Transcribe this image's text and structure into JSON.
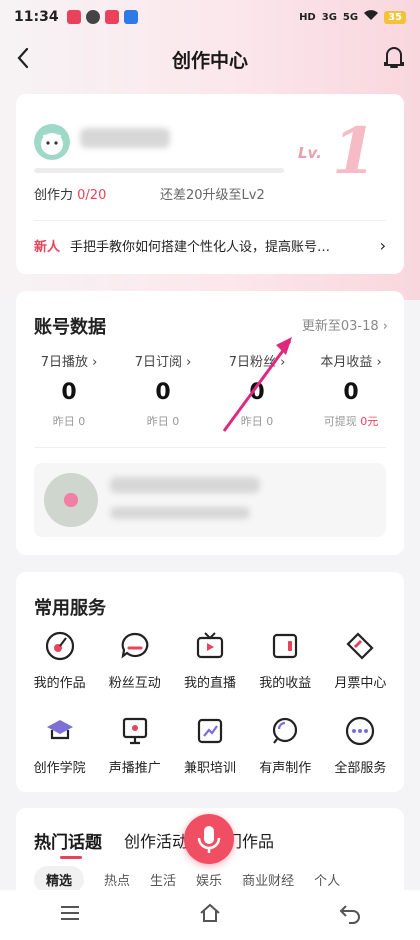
{
  "status_bar": {
    "time": "11:34",
    "signal_labels": [
      "HD",
      "3G",
      "5G"
    ],
    "battery": "35"
  },
  "header": {
    "title": "创作中心"
  },
  "profile": {
    "power_label": "创作力",
    "power_value": "0/20",
    "power_progress_fraction": 0,
    "upgrade_hint": "还差20升级至Lv2",
    "level_prefix": "Lv.",
    "level_number": "1",
    "tip_tag": "新人",
    "tip_text": "手把手教你如何搭建个性化人设，提高账号…",
    "tip_arrow": "›"
  },
  "account": {
    "title": "账号数据",
    "update_text": "更新至03-18 ›",
    "stats": [
      {
        "label": "7日播放 ›",
        "value": "0",
        "sub": "昨日 0",
        "sub_highlight": ""
      },
      {
        "label": "7日订阅 ›",
        "value": "0",
        "sub": "昨日 0",
        "sub_highlight": ""
      },
      {
        "label": "7日粉丝 ›",
        "value": "0",
        "sub": "昨日 0",
        "sub_highlight": ""
      },
      {
        "label": "本月收益 ›",
        "value": "0",
        "sub": "可提现 ",
        "sub_highlight": "0元"
      }
    ]
  },
  "services": {
    "title": "常用服务",
    "items": [
      {
        "label": "我的作品",
        "icon": "works-icon"
      },
      {
        "label": "粉丝互动",
        "icon": "chat-icon"
      },
      {
        "label": "我的直播",
        "icon": "live-icon"
      },
      {
        "label": "我的收益",
        "icon": "wallet-icon"
      },
      {
        "label": "月票中心",
        "icon": "ticket-icon"
      },
      {
        "label": "创作学院",
        "icon": "academy-icon"
      },
      {
        "label": "声播推广",
        "icon": "promote-icon"
      },
      {
        "label": "兼职培训",
        "icon": "training-icon"
      },
      {
        "label": "有声制作",
        "icon": "audio-make-icon"
      },
      {
        "label": "全部服务",
        "icon": "more-icon"
      }
    ]
  },
  "topics": {
    "tabs": [
      "热门话题",
      "创作活动",
      "热门作品"
    ],
    "chips": [
      "精选",
      "热点",
      "生活",
      "娱乐",
      "商业财经",
      "个人"
    ]
  },
  "colors": {
    "accent": "#e8435b",
    "background": "#f4f4f6"
  }
}
